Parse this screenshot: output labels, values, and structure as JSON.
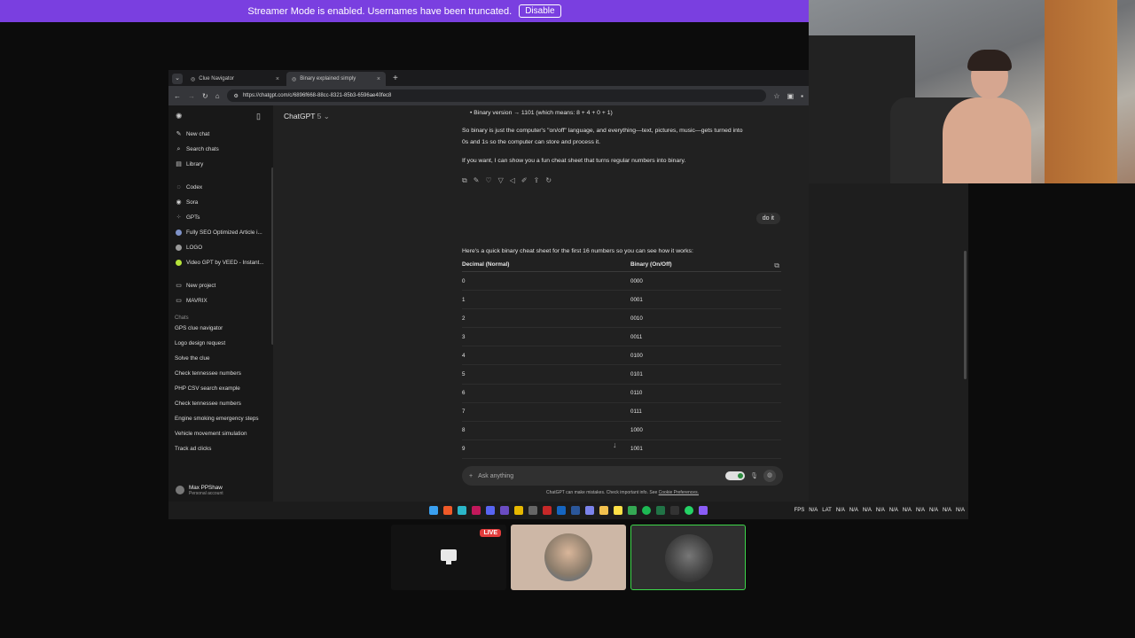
{
  "banner": {
    "message": "Streamer Mode is enabled. Usernames have been truncated.",
    "button": "Disable"
  },
  "browser": {
    "tabs": [
      {
        "label": "Clue Navigator",
        "active": false
      },
      {
        "label": "Binary explained simply",
        "active": true
      }
    ],
    "url": "https://chatgpt.com/c/6896f668-88cc-8321-85b3-6596ae40fec8"
  },
  "sidebar": {
    "top_items": [
      {
        "label": "New chat",
        "icon": "edit-icon"
      },
      {
        "label": "Search chats",
        "icon": "search-icon"
      },
      {
        "label": "Library",
        "icon": "library-icon"
      }
    ],
    "tools": [
      {
        "label": "Codex",
        "icon": "codex-icon"
      },
      {
        "label": "Sora",
        "icon": "sora-icon"
      },
      {
        "label": "GPTs",
        "icon": "grid-icon"
      },
      {
        "label": "Fully SEO Optimized Article i...",
        "icon": "gpt-avatar-icon"
      },
      {
        "label": "LOGO",
        "icon": "gpt-avatar-icon"
      },
      {
        "label": "Video GPT by VEED - Instant...",
        "icon": "gpt-avatar-icon"
      }
    ],
    "projects": [
      {
        "label": "New project",
        "icon": "folder-plus-icon"
      },
      {
        "label": "MAVRIX",
        "icon": "folder-icon"
      }
    ],
    "chats_label": "Chats",
    "chats": [
      "GPS clue navigator",
      "Logo design request",
      "Solve the clue",
      "Check tennessee numbers",
      "PHP CSV search example",
      "Check tennessee numbers",
      "Engine smoking emergency steps",
      "Vehicle movement simulation",
      "Track ad clicks"
    ],
    "user": {
      "name": "Max PPShaw",
      "plan": "Personal account"
    }
  },
  "chat": {
    "model": "ChatGPT",
    "model_version": "5",
    "bullet_binary": "Binary version → 1101 (which means: 8 + 4 + 0 + 1)",
    "para1_line1": "So binary is just the computer's \"on/off\" language, and everything—text, pictures, music—gets turned into",
    "para1_line2": "0s and 1s so the computer can store and process it.",
    "para2": "If you want, I can show you a fun cheat sheet that turns regular numbers into binary.",
    "user_message": "do it",
    "intro": "Here's a quick binary cheat sheet for the first 16 numbers so you can see how it works:",
    "table": {
      "headers": [
        "Decimal (Normal)",
        "Binary (On/Off)"
      ],
      "rows": [
        [
          "0",
          "0000"
        ],
        [
          "1",
          "0001"
        ],
        [
          "2",
          "0010"
        ],
        [
          "3",
          "0011"
        ],
        [
          "4",
          "0100"
        ],
        [
          "5",
          "0101"
        ],
        [
          "6",
          "0110"
        ],
        [
          "7",
          "0111"
        ],
        [
          "8",
          "1000"
        ],
        [
          "9",
          "1001"
        ]
      ]
    },
    "composer_placeholder": "Ask anything",
    "footer_note": "ChatGPT can make mistakes. Check important info. See ",
    "footer_link": "Cookie Preferences."
  },
  "taskbar": {
    "tray": [
      "FPS",
      "N/A",
      "LAT",
      "N/A",
      "N/A",
      "N/A",
      "N/A",
      "N/A",
      "N/A",
      "N/A",
      "N/A",
      "N/A",
      "N/A"
    ]
  },
  "stream": {
    "live_label": "LIVE"
  }
}
